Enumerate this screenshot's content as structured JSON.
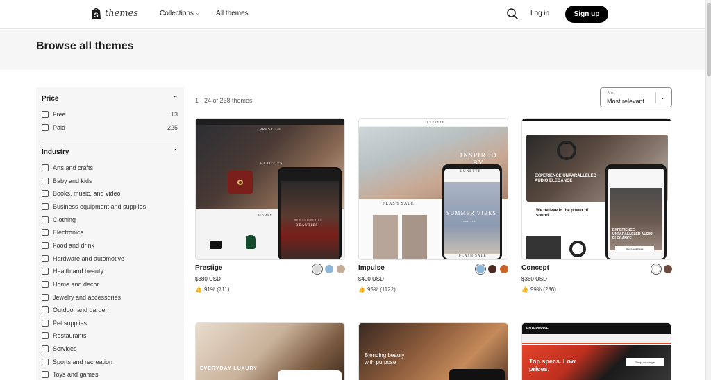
{
  "header": {
    "logo_text": "themes",
    "nav": {
      "collections": "Collections",
      "all_themes": "All themes"
    },
    "login": "Log in",
    "signup": "Sign up"
  },
  "page": {
    "title": "Browse all themes"
  },
  "filters": {
    "price": {
      "title": "Price",
      "options": [
        {
          "label": "Free",
          "count": "13"
        },
        {
          "label": "Paid",
          "count": "225"
        }
      ]
    },
    "industry": {
      "title": "Industry",
      "options": [
        "Arts and crafts",
        "Baby and kids",
        "Books, music, and video",
        "Business equipment and supplies",
        "Clothing",
        "Electronics",
        "Food and drink",
        "Hardware and automotive",
        "Health and beauty",
        "Home and decor",
        "Jewelry and accessories",
        "Outdoor and garden",
        "Pet supplies",
        "Restaurants",
        "Services",
        "Sports and recreation",
        "Toys and games"
      ]
    }
  },
  "results": {
    "count_text": "1 - 24 of 238 themes"
  },
  "sort": {
    "label": "Sort",
    "value": "Most relevant"
  },
  "themes": [
    {
      "name": "Prestige",
      "price": "$380 USD",
      "rating": "91% (711)",
      "swatches": [
        "#d9d9d9",
        "#8fb6d6",
        "#c3ad96"
      ],
      "preview": {
        "hero_text": "BEAUTIES",
        "mobile_text": "BEAUTIES",
        "women": "WOMEN",
        "new_collection": "NEW COLLECTION",
        "logo": "PRESTIGE"
      }
    },
    {
      "name": "Impulse",
      "price": "$400 USD",
      "rating": "95% (1122)",
      "swatches": [
        "#8fb6d6",
        "#4a2b22",
        "#c8652f"
      ],
      "preview": {
        "hero_text": "INSPIRED BY NATURE",
        "flash_sale": "FLASH SALE",
        "mobile_logo": "LUXETTE",
        "mobile_text": "SUMMER VIBES",
        "mobile_flash": "FLASH SALE",
        "logo": "LUXETTE",
        "shop_all": "SHOP ALL"
      }
    },
    {
      "name": "Concept",
      "price": "$360 USD",
      "rating": "99% (236)",
      "swatches": [
        "#ffffff",
        "#6b4a3d"
      ],
      "preview": {
        "hero_text": "EXPERIENCE UNPARALLELED AUDIO ELEGANCE",
        "sub_text": "We believe in the power of sound",
        "mobile_text": "EXPERIENCE UNPARALLELED AUDIO ELEGANCE",
        "button": "Shop Headphones"
      }
    }
  ],
  "themes_row2": [
    {
      "preview": {
        "hero_text": "EVERYDAY LUXURY"
      }
    },
    {
      "preview": {
        "hero_text": "Blending beauty with purpose"
      }
    },
    {
      "preview": {
        "logo": "ENTERPRISE",
        "hero_text": "Top specs. Low prices.",
        "button": "Shop our range"
      }
    }
  ]
}
